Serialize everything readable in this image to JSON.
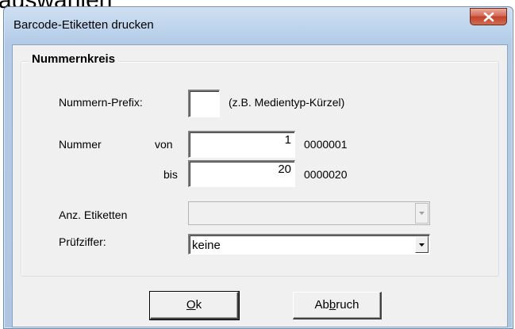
{
  "background": {
    "text": "auswählen"
  },
  "window": {
    "title": "Barcode-Etiketten drucken"
  },
  "group": {
    "title": "Nummernkreis"
  },
  "prefix": {
    "label": "Nummern-Prefix:",
    "value": "",
    "hint": "(z.B. Medientyp-Kürzel)"
  },
  "nummer": {
    "label": "Nummer",
    "von_label": "von",
    "von_value": "1",
    "von_formatted": "0000001",
    "bis_label": "bis",
    "bis_value": "20",
    "bis_formatted": "0000020"
  },
  "anz_etiketten": {
    "label": "Anz. Etiketten",
    "value": ""
  },
  "pruefziffer": {
    "label": "Prüfziffer:",
    "value": "keine"
  },
  "buttons": {
    "ok": {
      "accel": "O",
      "rest": "k"
    },
    "abbruch": {
      "pre": "Ab",
      "accel": "b",
      "rest": "ruch"
    }
  },
  "colors": {
    "close_button": "#c2432b",
    "titlebar": "#bcd3ec",
    "client": "#f0f0f0"
  }
}
